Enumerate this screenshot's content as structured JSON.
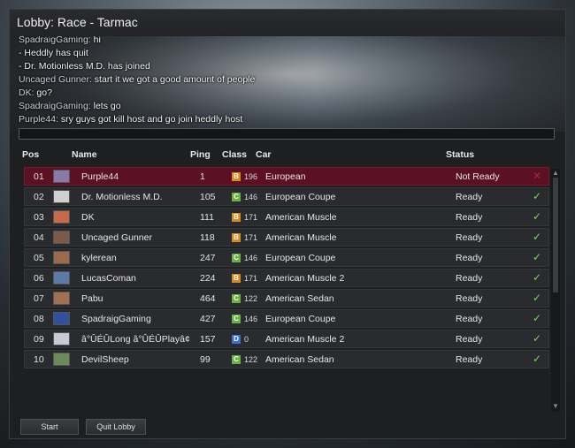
{
  "window": {
    "title": "Lobby: Race - Tarmac"
  },
  "chat": {
    "lines": [
      {
        "name": "SpadraigGaming:",
        "text": " hi"
      },
      {
        "name": "",
        "text": " - Heddly has quit"
      },
      {
        "name": "",
        "text": " - Dr. Motionless M.D. has joined"
      },
      {
        "name": "Uncaged Gunner:",
        "text": " start it we got a good amount of people"
      },
      {
        "name": "DK:",
        "text": " go?"
      },
      {
        "name": "SpadraigGaming:",
        "text": " lets go"
      },
      {
        "name": "Purple44:",
        "text": " sry guys got kill host and go join heddly host"
      }
    ],
    "input_value": ""
  },
  "table": {
    "headers": {
      "pos": "Pos",
      "name": "Name",
      "ping": "Ping",
      "class": "Class",
      "car": "Car",
      "status": "Status"
    },
    "rows": [
      {
        "pos": "01",
        "name": "Purple44",
        "ping": "1",
        "class_letter": "B",
        "class_value": "196",
        "car": "European",
        "status": "Not Ready",
        "selected": true,
        "ready": false
      },
      {
        "pos": "02",
        "name": "Dr. Motionless M.D.",
        "ping": "105",
        "class_letter": "C",
        "class_value": "146",
        "car": "European Coupe",
        "status": "Ready",
        "selected": false,
        "ready": true
      },
      {
        "pos": "03",
        "name": "DK",
        "ping": "111",
        "class_letter": "B",
        "class_value": "171",
        "car": "American Muscle",
        "status": "Ready",
        "selected": false,
        "ready": true
      },
      {
        "pos": "04",
        "name": "Uncaged Gunner",
        "ping": "118",
        "class_letter": "B",
        "class_value": "171",
        "car": "American Muscle",
        "status": "Ready",
        "selected": false,
        "ready": true
      },
      {
        "pos": "05",
        "name": "kylerean",
        "ping": "247",
        "class_letter": "C",
        "class_value": "146",
        "car": "European Coupe",
        "status": "Ready",
        "selected": false,
        "ready": true
      },
      {
        "pos": "06",
        "name": "LucasComan",
        "ping": "224",
        "class_letter": "B",
        "class_value": "171",
        "car": "American Muscle 2",
        "status": "Ready",
        "selected": false,
        "ready": true
      },
      {
        "pos": "07",
        "name": "Pabu",
        "ping": "464",
        "class_letter": "C",
        "class_value": "122",
        "car": "American Sedan",
        "status": "Ready",
        "selected": false,
        "ready": true
      },
      {
        "pos": "08",
        "name": "SpadraigGaming",
        "ping": "427",
        "class_letter": "C",
        "class_value": "146",
        "car": "European Coupe",
        "status": "Ready",
        "selected": false,
        "ready": true
      },
      {
        "pos": "09",
        "name": "â°ÛÉÛLong â°ÛÉÛPlayâ¢",
        "ping": "157",
        "class_letter": "D",
        "class_value": "0",
        "car": "American Muscle 2",
        "status": "Ready",
        "selected": false,
        "ready": true
      },
      {
        "pos": "10",
        "name": "DevilSheep",
        "ping": "99",
        "class_letter": "C",
        "class_value": "122",
        "car": "American Sedan",
        "status": "Ready",
        "selected": false,
        "ready": true
      }
    ],
    "ready_icon": "check-icon",
    "not_ready_icon": "close-icon"
  },
  "class_colors": {
    "B": "#d88a1c",
    "C": "#6ab043",
    "D": "#3f6fd0"
  },
  "avatar_colors": [
    "#8a7aa8",
    "#cfcfcf",
    "#c86a4a",
    "#7a5a4a",
    "#9b6a4a",
    "#5a7aa8",
    "#a07050",
    "#3050a0",
    "#c8c8d8",
    "#6a8a5a"
  ],
  "buttons": {
    "start": "Start",
    "quit": "Quit Lobby"
  }
}
